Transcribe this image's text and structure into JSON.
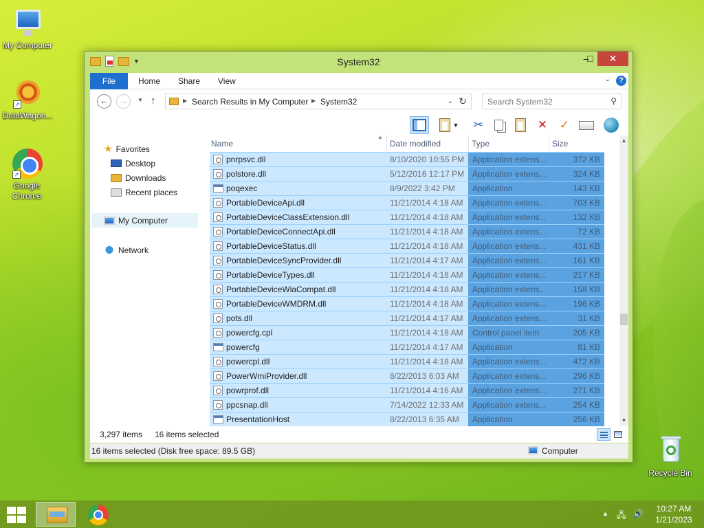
{
  "desktop": {
    "icons": [
      {
        "label": "My Computer",
        "icon": "my-computer-icon"
      },
      {
        "label": "DataWagon...",
        "icon": "datawagon-icon"
      },
      {
        "label": "Google Chrome",
        "icon": "chrome-icon"
      },
      {
        "label": "Recycle Bin",
        "icon": "recycle-bin-icon"
      }
    ]
  },
  "window": {
    "title": "System32",
    "controls": {
      "minimize": "–",
      "maximize": "□",
      "close": "✕"
    },
    "ribbon_tabs": [
      "File",
      "Home",
      "Share",
      "View"
    ],
    "help": "?",
    "address": {
      "crumbs": [
        "Search Results in My Computer",
        "System32"
      ]
    },
    "search": {
      "placeholder": "Search System32"
    },
    "navigation": {
      "favorites": "Favorites",
      "favorite_items": [
        "Desktop",
        "Downloads",
        "Recent places"
      ],
      "my_computer": "My Computer",
      "network": "Network"
    },
    "columns": [
      "Name",
      "Date modified",
      "Type",
      "Size"
    ],
    "files": [
      {
        "name": "pnrpsvc.dll",
        "date": "8/10/2020 10:55 PM",
        "type": "Application extens...",
        "size": "372 KB",
        "kind": "dll"
      },
      {
        "name": "polstore.dll",
        "date": "5/12/2016 12:17 PM",
        "type": "Application extens...",
        "size": "324 KB",
        "kind": "dll"
      },
      {
        "name": "poqexec",
        "date": "8/9/2022 3:42 PM",
        "type": "Application",
        "size": "143 KB",
        "kind": "exe"
      },
      {
        "name": "PortableDeviceApi.dll",
        "date": "11/21/2014 4:18 AM",
        "type": "Application extens...",
        "size": "703 KB",
        "kind": "dll"
      },
      {
        "name": "PortableDeviceClassExtension.dll",
        "date": "11/21/2014 4:18 AM",
        "type": "Application extens...",
        "size": "132 KB",
        "kind": "dll"
      },
      {
        "name": "PortableDeviceConnectApi.dll",
        "date": "11/21/2014 4:18 AM",
        "type": "Application extens...",
        "size": "72 KB",
        "kind": "dll"
      },
      {
        "name": "PortableDeviceStatus.dll",
        "date": "11/21/2014 4:18 AM",
        "type": "Application extens...",
        "size": "431 KB",
        "kind": "dll"
      },
      {
        "name": "PortableDeviceSyncProvider.dll",
        "date": "11/21/2014 4:17 AM",
        "type": "Application extens...",
        "size": "161 KB",
        "kind": "dll"
      },
      {
        "name": "PortableDeviceTypes.dll",
        "date": "11/21/2014 4:18 AM",
        "type": "Application extens...",
        "size": "217 KB",
        "kind": "dll"
      },
      {
        "name": "PortableDeviceWiaCompat.dll",
        "date": "11/21/2014 4:18 AM",
        "type": "Application extens...",
        "size": "158 KB",
        "kind": "dll"
      },
      {
        "name": "PortableDeviceWMDRM.dll",
        "date": "11/21/2014 4:18 AM",
        "type": "Application extens...",
        "size": "196 KB",
        "kind": "dll"
      },
      {
        "name": "pots.dll",
        "date": "11/21/2014 4:17 AM",
        "type": "Application extens...",
        "size": "31 KB",
        "kind": "dll"
      },
      {
        "name": "powercfg.cpl",
        "date": "11/21/2014 4:18 AM",
        "type": "Control panel item",
        "size": "205 KB",
        "kind": "dll"
      },
      {
        "name": "powercfg",
        "date": "11/21/2014 4:17 AM",
        "type": "Application",
        "size": "81 KB",
        "kind": "exe"
      },
      {
        "name": "powercpl.dll",
        "date": "11/21/2014 4:18 AM",
        "type": "Application extens...",
        "size": "472 KB",
        "kind": "dll"
      },
      {
        "name": "PowerWmiProvider.dll",
        "date": "8/22/2013 6:03 AM",
        "type": "Application extens...",
        "size": "296 KB",
        "kind": "dll"
      },
      {
        "name": "powrprof.dll",
        "date": "11/21/2014 4:16 AM",
        "type": "Application extens...",
        "size": "271 KB",
        "kind": "dll"
      },
      {
        "name": "ppcsnap.dll",
        "date": "7/14/2022 12:33 AM",
        "type": "Application extens...",
        "size": "254 KB",
        "kind": "dll"
      },
      {
        "name": "PresentationHost",
        "date": "8/22/2013 6:35 AM",
        "type": "Application",
        "size": "256 KB",
        "kind": "exe"
      }
    ],
    "status": {
      "item_count": "3,297 items",
      "selected": "16 items selected",
      "details": "16 items selected (Disk free space: 89.5 GB)",
      "location": "Computer"
    }
  },
  "taskbar": {
    "time": "10:27 AM",
    "date": "1/21/2023"
  },
  "colors": {
    "accent": "#1e6fd0",
    "selection": "#cce8ff",
    "selection_highlight": "#5ba3e0"
  }
}
